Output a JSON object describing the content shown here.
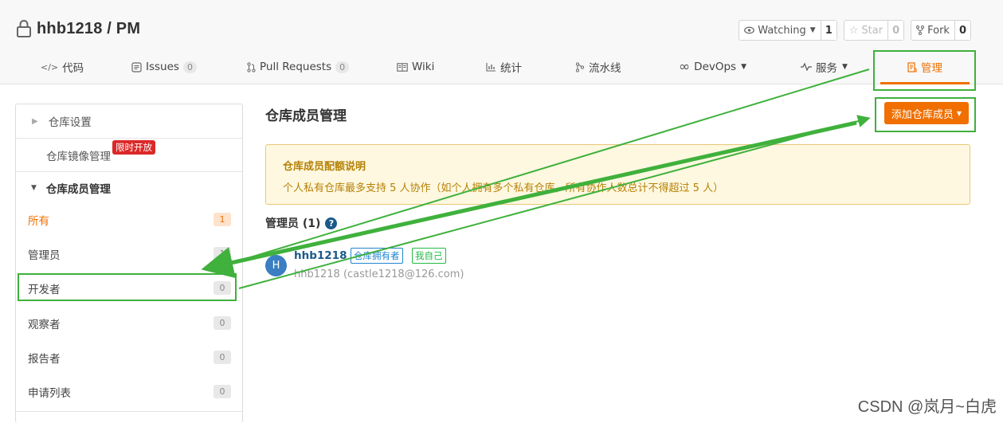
{
  "repo": {
    "owner_repo": "hhb1218 / PM"
  },
  "actions": {
    "watching": {
      "label": "Watching",
      "count": "1"
    },
    "star": {
      "label": "Star",
      "count": "0"
    },
    "fork": {
      "label": "Fork",
      "count": "0"
    }
  },
  "tabs": [
    {
      "label": "代码"
    },
    {
      "label": "Issues",
      "count": "0"
    },
    {
      "label": "Pull Requests",
      "count": "0"
    },
    {
      "label": "Wiki"
    },
    {
      "label": "统计"
    },
    {
      "label": "流水线"
    },
    {
      "label": "DevOps"
    },
    {
      "label": "服务"
    },
    {
      "label": "管理"
    }
  ],
  "sidebar": {
    "repo_settings": "仓库设置",
    "mirror_mgmt": "仓库镜像管理",
    "limited_tag": "限时开放",
    "member_mgmt": "仓库成员管理",
    "items": [
      {
        "label": "所有",
        "count": "1"
      },
      {
        "label": "管理员",
        "count": "1"
      },
      {
        "label": "开发者",
        "count": "0"
      },
      {
        "label": "观察者",
        "count": "0"
      },
      {
        "label": "报告者",
        "count": "0"
      },
      {
        "label": "申请列表",
        "count": "0"
      }
    ]
  },
  "main": {
    "title": "仓库成员管理",
    "add_button": "添加仓库成员",
    "notice_title": "仓库成员配额说明",
    "notice_desc": "个人私有仓库最多支持 5 人协作（如个人拥有多个私有仓库，所有协作人数总计不得超过 5 人）",
    "admins_heading": "管理员 (1)",
    "member": {
      "avatar_letter": "H",
      "name": "hhb1218",
      "tag_owner": "仓库拥有者",
      "tag_self": "我自己",
      "email": "hhb1218 (castle1218@126.com)"
    }
  },
  "watermark": "CSDN @岚月~白虎",
  "colors": {
    "accent": "#f06f00",
    "annotation": "#3fb13c",
    "link": "#1a5a8a"
  }
}
